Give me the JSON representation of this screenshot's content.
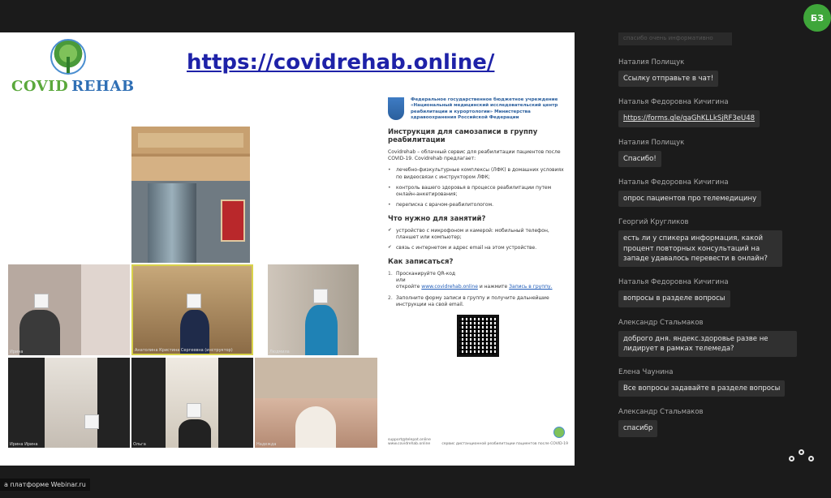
{
  "user": {
    "initials": "БЗ",
    "avatar_color": "#3fa63a"
  },
  "slide": {
    "logo": {
      "word1": "COVID",
      "word2": "REHAB"
    },
    "url": "https://covidrehab.online/",
    "participants": [
      "Ирина",
      "Анатолина Кристина Сергеевна (инструктор)",
      "Людмила",
      "Ирина Ирина",
      "Ольга",
      "Надежда"
    ],
    "doc": {
      "org": "Федеральное государственное бюджетное учреждение «Национальный медицинский исследовательский центр реабилитации и курортологии» Министерства здравоохранения Российской Федерации",
      "title": "Инструкция для самозаписи в группу реабилитации",
      "intro": "Covidrehab – облачный сервис для реабилитации пациентов после COVID-19. Covidrehab предлагает:",
      "offers": [
        "лечебно-физкультурные комплексы (ЛФК) в домашних условиях по видеосвязи с инструктором ЛФК;",
        "контроль вашего здоровья в процессе реабилитации путем онлайн-анкетирования;",
        "переписка с врачом-реабилитологом."
      ],
      "needs_title": "Что нужно для занятий?",
      "needs": [
        "устройство с микрофоном и камерой: мобильный телефон, планшет или компьютер;",
        "связь с интернетом и адрес email на этом устройстве."
      ],
      "signup_title": "Как записаться?",
      "step1_a": "Просканируйте QR-код",
      "step1_b": "или",
      "step1_c": "откройте",
      "step1_link": "www.covidrehab.online",
      "step1_d": "и нажмите",
      "step1_e": "Запись в группу.",
      "step2": "Заполните форму записи в группу и получите дальнейшие инструкции на свой email.",
      "footer_left": "support@telepat.online\nwww.covidrehab.online",
      "footer_right": "сервис дистанционной реабилитации пациентов после COVID-19"
    }
  },
  "chat": {
    "faded_text": "спасибо очень информативно",
    "messages": [
      {
        "author": "Наталия Полищук",
        "text": "Ссылку отправьте в чат!"
      },
      {
        "author": "Наталья Федоровна Кичигина",
        "text": "https://forms.gle/gaGhKLLkSjRF3eU48",
        "link": true
      },
      {
        "author": "Наталия Полищук",
        "text": "Спасибо!"
      },
      {
        "author": "Наталья Федоровна Кичигина",
        "text": "опрос пациентов про телемедицину"
      },
      {
        "author": "Георгий Кругликов",
        "text": "есть ли у спикера информация, какой процент повторных консультаций на западе удавалось перевести в онлайн?"
      },
      {
        "author": "Наталья Федоровна Кичигина",
        "text": "вопросы в разделе вопросы"
      },
      {
        "author": "Александр Стальмаков",
        "text": "доброго дня. яндекс.здоровье разве не лидирует в рамках телемеда?"
      },
      {
        "author": "Елена Чаунина",
        "text": "Все вопросы задавайте в разделе вопросы"
      },
      {
        "author": "Александр Стальмаков",
        "text": "спасибр"
      }
    ]
  },
  "footer": {
    "platform_text": "а платформе Webinar.ru"
  }
}
